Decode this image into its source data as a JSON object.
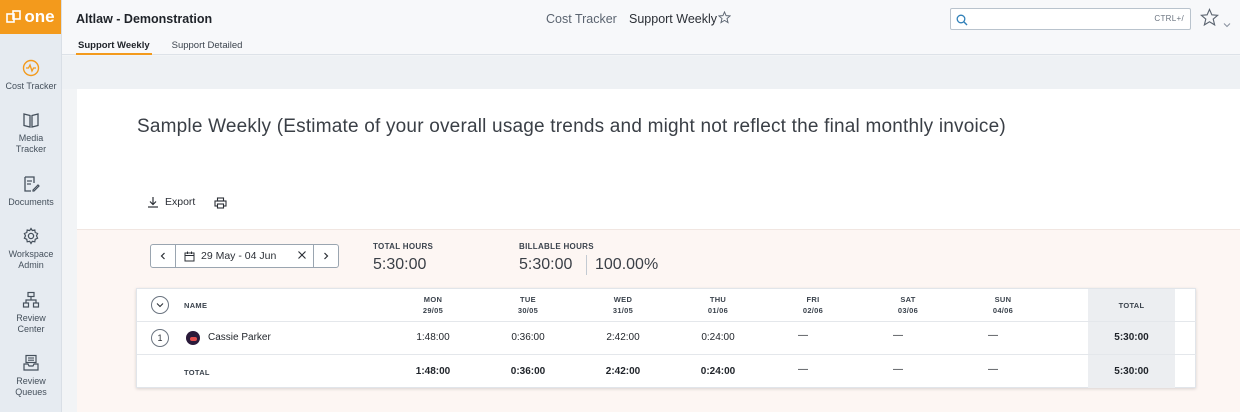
{
  "logo": {
    "text": "one"
  },
  "sidebar": {
    "items": [
      {
        "label": "Cost Tracker",
        "icon": "activity-icon"
      },
      {
        "label": "Media\nTracker",
        "icon": "book-icon"
      },
      {
        "label": "Documents",
        "icon": "document-edit-icon"
      },
      {
        "label": "Workspace\nAdmin",
        "icon": "gear-icon"
      },
      {
        "label": "Review\nCenter",
        "icon": "network-icon"
      },
      {
        "label": "Review\nQueues",
        "icon": "inbox-icon"
      }
    ]
  },
  "header": {
    "app_title": "Altlaw - Demonstration",
    "breadcrumb_parent": "Cost Tracker",
    "breadcrumb_current": "Support Weekly",
    "search_placeholder": "",
    "search_hint": "CTRL+/"
  },
  "tabs": [
    {
      "label": "Support Weekly",
      "active": true
    },
    {
      "label": "Support Detailed",
      "active": false
    }
  ],
  "page": {
    "title": "Sample Weekly (Estimate of your overall usage trends and might not reflect the final monthly invoice)",
    "export_label": "Export"
  },
  "summary": {
    "date_range": "29 May - 04 Jun",
    "total_hours_label": "TOTAL HOURS",
    "total_hours_value": "5:30:00",
    "billable_hours_label": "BILLABLE HOURS",
    "billable_hours_value": "5:30:00",
    "billable_percent": "100.00%"
  },
  "table": {
    "name_header": "NAME",
    "total_header": "TOTAL",
    "days": [
      {
        "day": "MON",
        "date": "29/05"
      },
      {
        "day": "TUE",
        "date": "30/05"
      },
      {
        "day": "WED",
        "date": "31/05"
      },
      {
        "day": "THU",
        "date": "01/06"
      },
      {
        "day": "FRI",
        "date": "02/06"
      },
      {
        "day": "SAT",
        "date": "03/06"
      },
      {
        "day": "SUN",
        "date": "04/06"
      }
    ],
    "rows": [
      {
        "index": "1",
        "name": "Cassie Parker",
        "values": [
          "1:48:00",
          "0:36:00",
          "2:42:00",
          "0:24:00",
          "—",
          "—",
          "—"
        ],
        "total": "5:30:00"
      }
    ],
    "footer": {
      "label": "TOTAL",
      "values": [
        "1:48:00",
        "0:36:00",
        "2:42:00",
        "0:24:00",
        "—",
        "—",
        "—"
      ],
      "total": "5:30:00"
    }
  },
  "colors": {
    "accent": "#f39a1c",
    "sidebar_bg": "#e6ebf1",
    "summary_bg": "#fdf6f3"
  }
}
